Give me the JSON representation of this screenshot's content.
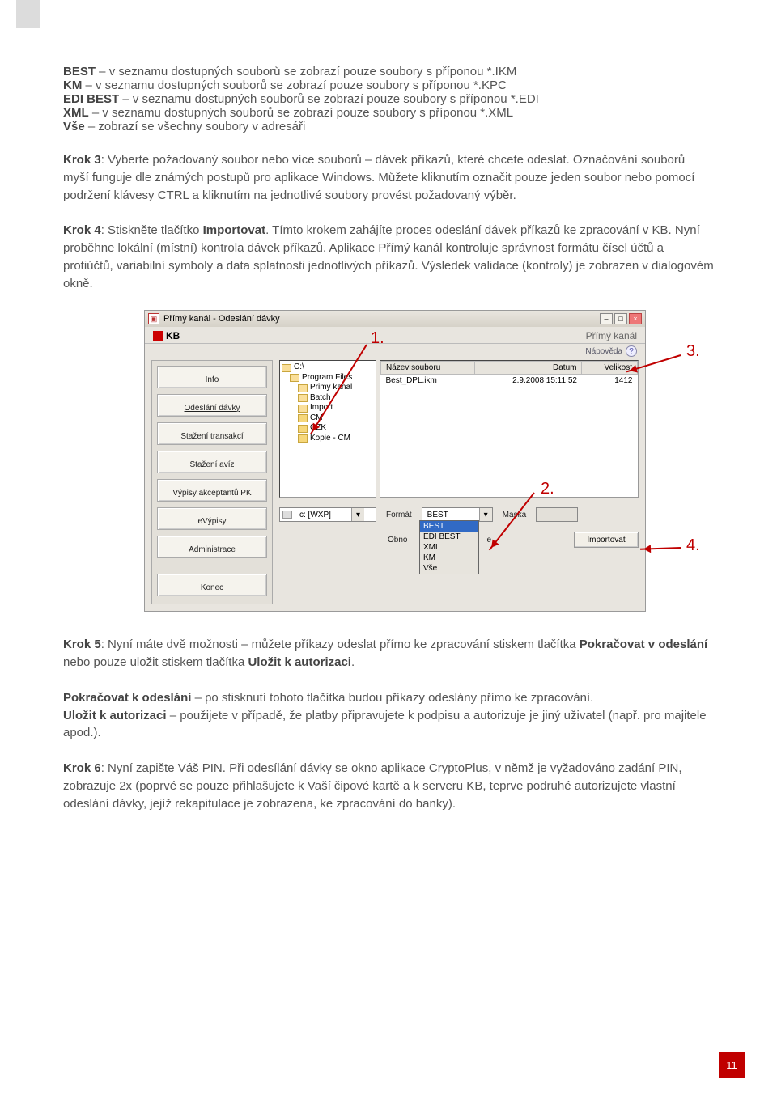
{
  "intro_lines": [
    {
      "b": "BEST",
      "t": " – v seznamu dostupných souborů se zobrazí pouze soubory s příponou *.IKM"
    },
    {
      "b": "KM",
      "t": " – v seznamu dostupných souborů se zobrazí pouze soubory s příponou *.KPC"
    },
    {
      "b": "EDI BEST",
      "t": " – v seznamu dostupných souborů se zobrazí pouze soubory s příponou *.EDI"
    },
    {
      "b": "XML",
      "t": " – v seznamu dostupných souborů se zobrazí pouze soubory s příponou *.XML"
    },
    {
      "b": "Vše",
      "t": " – zobrazí se všechny soubory v adresáři"
    }
  ],
  "p_k3a": "Krok 3",
  "p_k3b": ": Vyberte požadovaný soubor nebo více souborů – dávek příkazů, které chcete odeslat. Označování souborů myší funguje dle známých postupů pro aplikace Windows. Můžete kliknutím označit pouze jeden soubor nebo pomocí podržení klávesy CTRL a kliknutím na jednotlivé soubory provést požadovaný výběr.",
  "p_k4a": "Krok 4",
  "p_k4b": ": Stiskněte tlačítko ",
  "p_k4c": "Importovat",
  "p_k4d": ". Tímto krokem zahájíte proces odeslání dávek příkazů ke zpracování v KB. Nyní proběhne lokální (místní) kontrola dávek příkazů. Aplikace Přímý kanál kontroluje správnost formátu čísel účtů a protiúčtů, variabilní symboly a data splatnosti jednotlivých příkazů. Výsledek validace (kontroly) je zobrazen v dialogovém okně.",
  "p_k5a": "Krok 5",
  "p_k5b": ": Nyní máte dvě možnosti – můžete příkazy odeslat přímo ke zpracování stiskem tlačítka ",
  "p_k5c": "Pokračovat v odeslání",
  "p_k5d": " nebo pouze uložit stiskem tlačítka ",
  "p_k5e": "Uložit k autorizaci",
  "p_k5f": ".",
  "p_po1": "Pokračovat k odeslání",
  "p_po2": " – po stisknutí tohoto tlačítka budou příkazy odeslány přímo ke zpracování.",
  "p_ul1": "Uložit k autorizaci",
  "p_ul2": " – použijete v případě, že platby připravujete k podpisu a autorizuje je jiný uživatel (např. pro majitele apod.).",
  "p_k6a": "Krok 6",
  "p_k6b": ": Nyní zapište Váš PIN. Při odesílání dávky se okno aplikace CryptoPlus, v němž je vyžadováno zadání PIN, zobrazuje 2x (poprvé se pouze přihlašujete k Vaší čipové kartě a k serveru KB, teprve podruhé autorizujete vlastní odeslání dávky, jejíž rekapitulace je zobrazena, ke zpracování do banky).",
  "win": {
    "title": "Přímý kanál - Odeslání dávky",
    "kb": "KB",
    "sub": "Přímý kanál",
    "help": "Nápověda",
    "nav": [
      "Info",
      "Odeslání dávky",
      "Stažení transakcí",
      "Stažení avíz",
      "Výpisy akceptantů PK",
      "eVýpisy",
      "Administrace",
      "Konec"
    ],
    "tree": [
      "C:\\",
      "Program Files",
      "Primy kanal",
      "Batch",
      "Import",
      "CM",
      "CZK",
      "Kopie - CM"
    ],
    "file_th": [
      "Název souboru",
      "Datum",
      "Velikost"
    ],
    "file_row": [
      "Best_DPL.ikm",
      "2.9.2008 15:11:52",
      "1412"
    ],
    "drive": "c: [WXP]",
    "lbl_format": "Formát",
    "val_format": "BEST",
    "lbl_maska": "Maska",
    "lbl_obno": "Obno",
    "btn_import": "Importovat",
    "dropdown": [
      "BEST",
      "EDI BEST",
      "XML",
      "KM",
      "Vše"
    ],
    "e_label": "e"
  },
  "callouts": {
    "c1": "1.",
    "c2": "2.",
    "c3": "3.",
    "c4": "4."
  },
  "pagenum": "11"
}
